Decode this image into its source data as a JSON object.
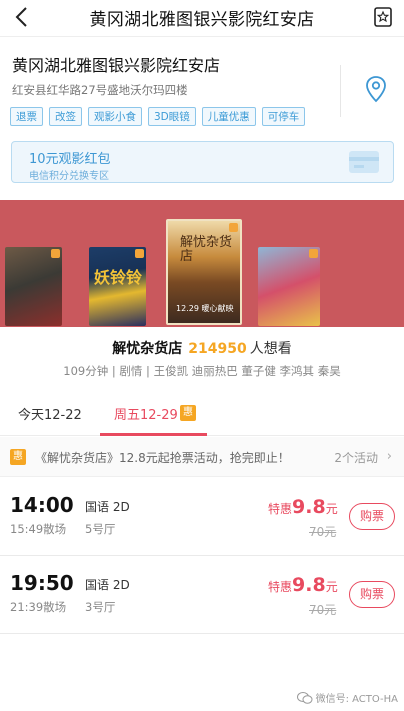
{
  "navbar": {
    "title": "黄冈湖北雅图银兴影院红安店",
    "back_icon": "chevron-left-icon",
    "favorite_icon": "bookmark-icon"
  },
  "cinema": {
    "name": "黄冈湖北雅图银兴影院红安店",
    "address": "红安县红华路27号盛地沃尔玛四楼",
    "tags": [
      "退票",
      "改签",
      "观影小食",
      "3D眼镜",
      "儿童优惠",
      "可停车"
    ],
    "location_icon": "map-pin-icon"
  },
  "promo": {
    "title": "10元观影红包",
    "subtitle": "电信积分兑换专区",
    "icon": "card-icon"
  },
  "posters": {
    "selected_title_art": "解忧杂货店",
    "selected_date_art": "12.29 暖心献映",
    "side_title_art": "妖铃铃"
  },
  "movie": {
    "name": "解忧杂货店",
    "want_count": "214950",
    "want_label": "人想看",
    "meta": "109分钟 | 剧情 | 王俊凯 迪丽热巴 董子健 李鸿其 秦昊"
  },
  "tabs": {
    "today": "今天12-22",
    "friday": "周五12-29",
    "badge": "惠"
  },
  "activity": {
    "badge": "惠",
    "text": "《解忧杂货店》12.8元起抢票活动，抢完即止！",
    "count": "2个活动",
    "chevron": "›"
  },
  "showtimes": [
    {
      "start": "14:00",
      "end": "15:49散场",
      "lang": "国语 2D",
      "hall": "5号厅",
      "special_label": "特惠",
      "price": "9.8",
      "price_unit": "元",
      "original": "70元",
      "buy": "购票"
    },
    {
      "start": "19:50",
      "end": "21:39散场",
      "lang": "国语 2D",
      "hall": "3号厅",
      "special_label": "特惠",
      "price": "9.8",
      "price_unit": "元",
      "original": "70元",
      "buy": "购票"
    }
  ],
  "watermark": {
    "text": "微信号: ACTO-HA"
  },
  "colors": {
    "accent_red": "#e84a5f",
    "orange": "#f5a623",
    "blue": "#3d97d3",
    "poster_bg": "#c9585d"
  }
}
